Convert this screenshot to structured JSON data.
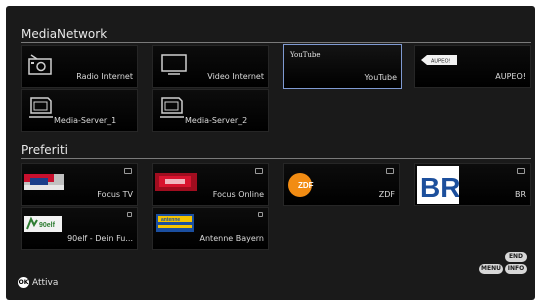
{
  "sections": {
    "media_network": {
      "title": "MediaNetwork",
      "tiles": [
        {
          "label": "Radio Internet",
          "icon": "radio-icon"
        },
        {
          "label": "Video Internet",
          "icon": "monitor-icon"
        },
        {
          "label": "YouTube",
          "icon": "youtube-logo",
          "logo_text": "YouTube",
          "selected": true
        },
        {
          "label": "AUPEO!",
          "icon": "aupeo-logo",
          "logo_text": "AUPEO!"
        },
        {
          "label": "Media-Server_1",
          "icon": "media-server-icon"
        },
        {
          "label": "Media-Server_2",
          "icon": "media-server-icon"
        }
      ]
    },
    "favorites": {
      "title": "Preferiti",
      "tiles": [
        {
          "label": "Focus TV",
          "icon": "focus-tv-logo"
        },
        {
          "label": "Focus Online",
          "icon": "focus-online-logo"
        },
        {
          "label": "ZDF",
          "icon": "zdf-logo",
          "logo_text": "ZDF"
        },
        {
          "label": "BR",
          "icon": "br-logo",
          "logo_text": "BR"
        },
        {
          "label": "90elf - Dein Fu...",
          "icon": "90elf-logo",
          "logo_text": "90elf"
        },
        {
          "label": "Antenne Bayern",
          "icon": "antenne-bayern-logo",
          "logo_text": "antenne"
        }
      ]
    }
  },
  "footer": {
    "ok_key": "OK",
    "ok_action": "Attiva",
    "end_key": "END",
    "menu_key": "MENU",
    "info_key": "INFO"
  },
  "colors": {
    "background": "#1a1a1a",
    "selection_border": "#7f9ad2",
    "text": "#dcdcdc"
  }
}
